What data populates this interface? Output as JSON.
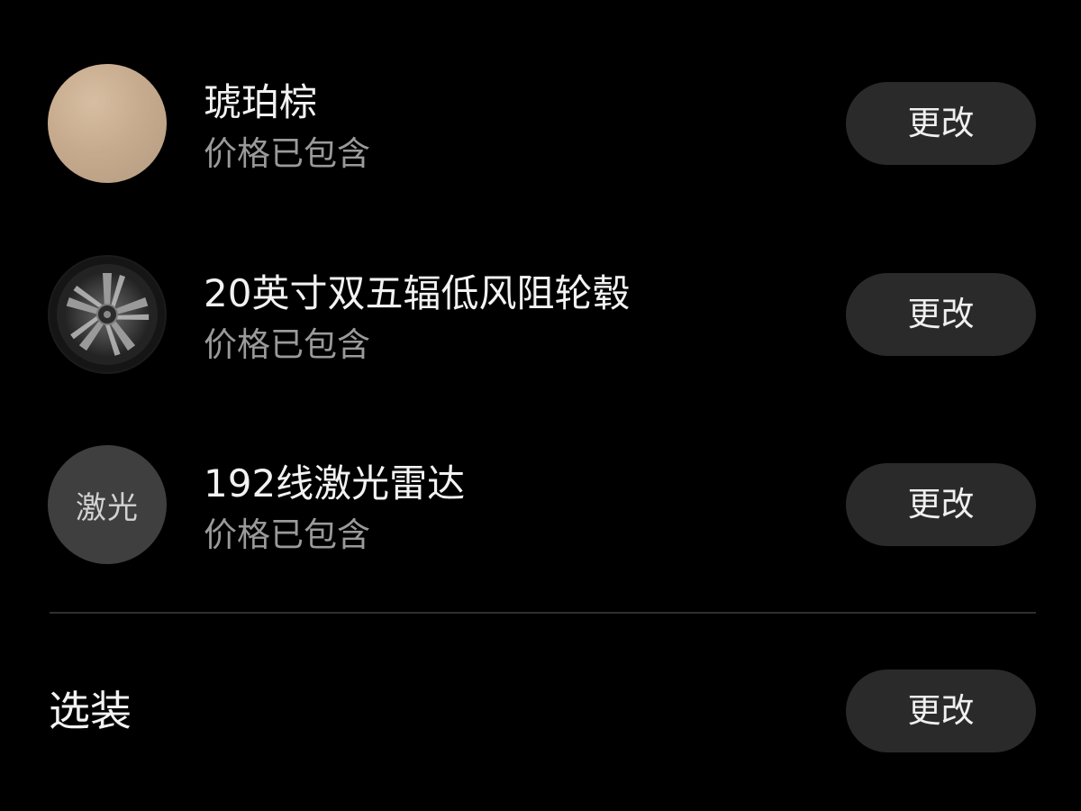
{
  "items": [
    {
      "name": "琥珀棕",
      "subtitle": "价格已包含",
      "thumb_type": "color-swatch",
      "swatch_color": "#c6ab8f",
      "button_label": "更改"
    },
    {
      "name": "20英寸双五辐低风阻轮毂",
      "subtitle": "价格已包含",
      "thumb_type": "wheel-icon",
      "button_label": "更改"
    },
    {
      "name": "192线激光雷达",
      "subtitle": "价格已包含",
      "thumb_type": "text-badge",
      "thumb_text": "激光",
      "button_label": "更改"
    }
  ],
  "options": {
    "label": "选装",
    "button_label": "更改"
  },
  "colors": {
    "background": "#000000",
    "button_bg": "#2a2a2a",
    "subtitle_text": "#9a9a9a",
    "divider": "#2f2f2f"
  }
}
